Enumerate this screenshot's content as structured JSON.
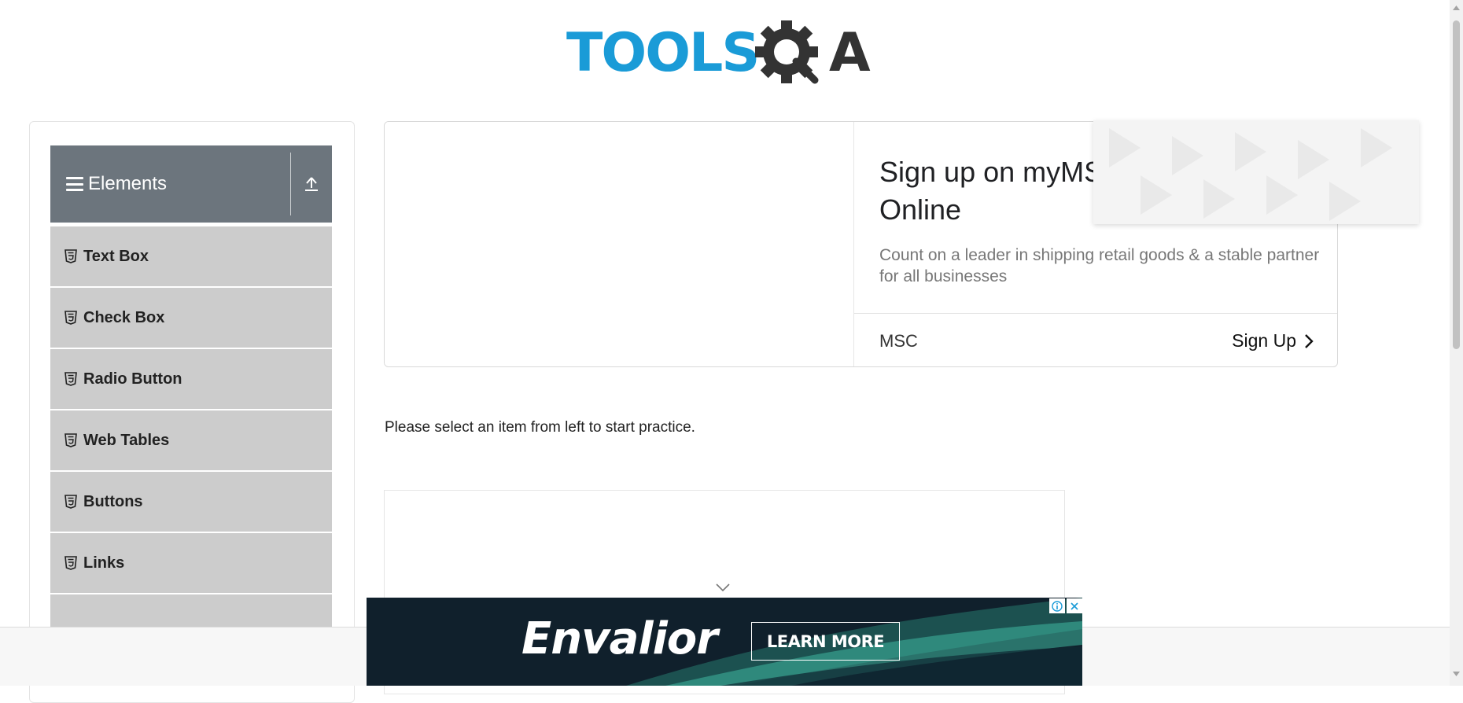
{
  "header": {
    "logo_text": "TOOLSQA",
    "logo_colors": {
      "primary": "#1a9bd7",
      "secondary": "#333333"
    }
  },
  "sidebar": {
    "group_title": "Elements",
    "items": [
      {
        "label": "Text Box"
      },
      {
        "label": "Check Box"
      },
      {
        "label": "Radio Button"
      },
      {
        "label": "Web Tables"
      },
      {
        "label": "Buttons"
      },
      {
        "label": "Links"
      },
      {
        "label": ""
      }
    ]
  },
  "ad_top": {
    "title": "Sign up on myMS\nOnline",
    "description": "Count on a leader in shipping retail goods & a stable partner for all businesses",
    "brand": "MSC",
    "cta": "Sign Up"
  },
  "main": {
    "instruction": "Please select an item from left to start practice."
  },
  "ad_banner": {
    "brand": "Envalior",
    "cta": "LEARN MORE"
  },
  "colors": {
    "sidebar_header": "#6c757d",
    "menu_item": "#cccccc",
    "banner_bg": "#10202c",
    "banner_accent": "#3fb8a0"
  }
}
